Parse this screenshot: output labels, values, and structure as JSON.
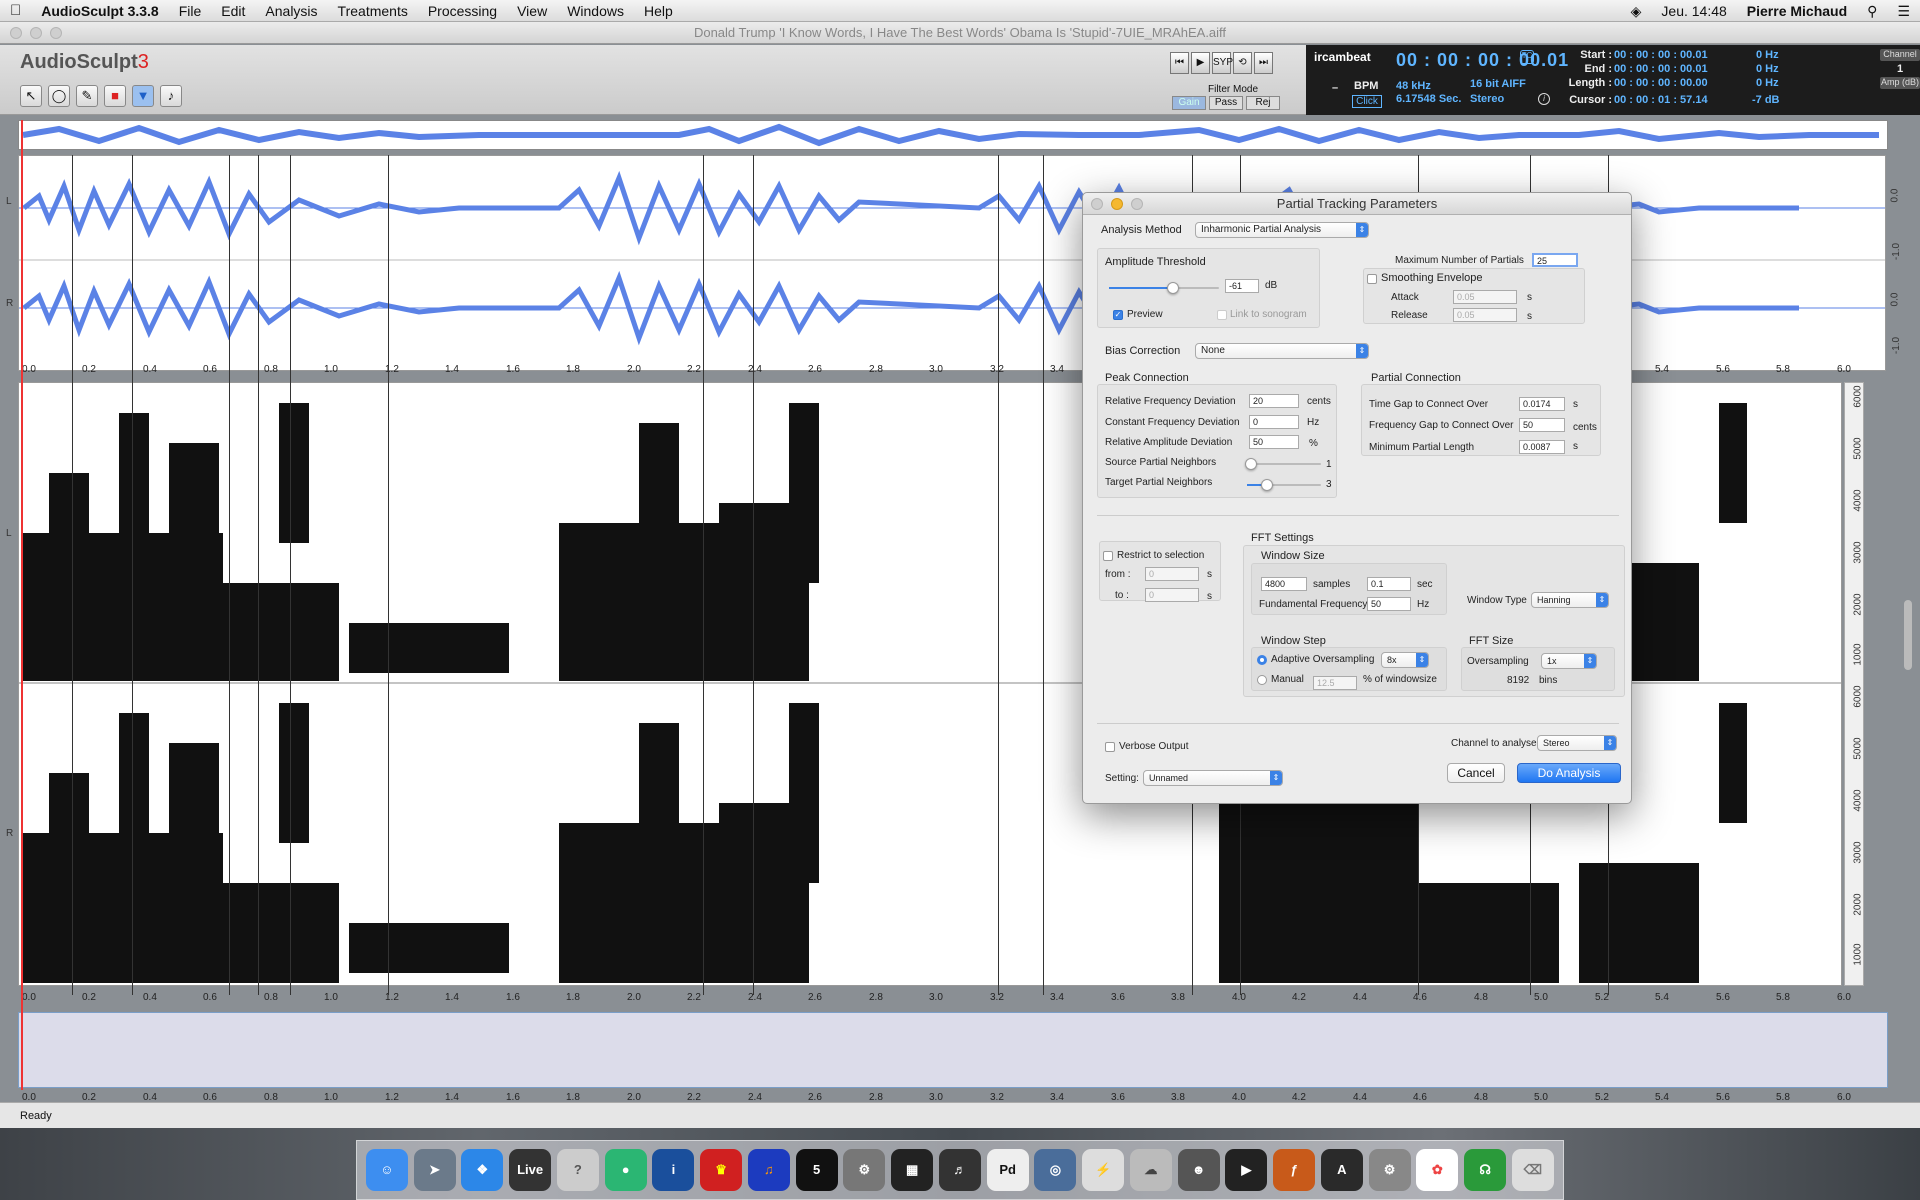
{
  "menubar": {
    "app": "AudioSculpt 3.3.8",
    "items": [
      "File",
      "Edit",
      "Analysis",
      "Treatments",
      "Processing",
      "View",
      "Windows",
      "Help"
    ],
    "clock": "Jeu. 14:48",
    "user": "Pierre Michaud"
  },
  "window": {
    "title": "Donald Trump 'I Know Words, I Have The Best Words' Obama Is 'Stupid'-7UIE_MRAhEA.aiff"
  },
  "toolbar": {
    "logo_text": "AudioSculpt",
    "logo_num": "3",
    "transport": [
      "⏮",
      "▶",
      "SYP",
      "⟲",
      "⏭"
    ],
    "filter_mode_label": "Filter Mode",
    "filter_buttons": [
      "Gain",
      "Pass",
      "Rej"
    ]
  },
  "info": {
    "brand": "ircambeat",
    "time": "00 : 00 : 00 : 00.01",
    "bpm": "BPM",
    "click": "Click",
    "rate": "48 kHz",
    "duration": "6.17548 Sec.",
    "format": "16 bit AIFF",
    "mode": "Stereo",
    "start_label": "Start :",
    "start": "00 : 00 : 00 : 00.01",
    "end_label": "End :",
    "end": "00 : 00 : 00 : 00.01",
    "length_label": "Length :",
    "length": "00 : 00 : 00 : 00.00",
    "cursor_label": "Cursor :",
    "cursor": "00 : 00 : 01 : 57.14",
    "hz1": "0 Hz",
    "hz2": "0 Hz",
    "hz3": "0 Hz",
    "hz4": "0 Hz",
    "amp": "-7 dB",
    "channel_label": "Channel",
    "channel": "1",
    "amp_label": "Amp (dB)"
  },
  "ruler_ticks": [
    "0.0",
    "0.2",
    "0.4",
    "0.6",
    "0.8",
    "1.0",
    "1.2",
    "1.4",
    "1.6",
    "1.8",
    "2.0",
    "2.2",
    "2.4",
    "2.6",
    "2.8",
    "3.0",
    "3.2",
    "3.4",
    "3.6",
    "3.8",
    "4.0",
    "4.2",
    "4.4",
    "4.6",
    "4.8",
    "5.0",
    "5.2",
    "5.4",
    "5.6",
    "5.8",
    "6.0"
  ],
  "freq_ticks": [
    "6000",
    "5000",
    "4000",
    "3000",
    "2000",
    "1000"
  ],
  "wave_scale": [
    "0.0",
    "-1.0"
  ],
  "channels": {
    "left": "L",
    "right": "R"
  },
  "status": "Ready",
  "dock": [
    "Finder",
    "Launchpad",
    "Safari",
    "Live",
    "?",
    "Rhythm",
    "Info",
    "Isadora",
    "Audacity",
    "5",
    "Settings",
    "Keys",
    "Pro",
    "Pd",
    "Radar",
    "Cable",
    "Cloud",
    "Mask",
    "Film",
    "ƒ",
    "A",
    "Prefs",
    "Photos",
    "Mic",
    "Trash"
  ],
  "dialog": {
    "title": "Partial Tracking Parameters",
    "analysis_method_label": "Analysis Method",
    "analysis_method": "Inharmonic Partial Analysis",
    "amp_threshold_label": "Amplitude Threshold",
    "amp_threshold": "-61",
    "amp_unit": "dB",
    "preview_label": "Preview",
    "link_label": "Link to sonogram",
    "max_partials_label": "Maximum Number of Partials",
    "max_partials": "25",
    "smoothing_label": "Smoothing Envelope",
    "attack_label": "Attack",
    "attack": "0.05",
    "release_label": "Release",
    "release": "0.05",
    "sec": "s",
    "bias_label": "Bias Correction",
    "bias": "None",
    "peak_label": "Peak Connection",
    "rel_freq_label": "Relative Frequency Deviation",
    "rel_freq": "20",
    "cents": "cents",
    "const_freq_label": "Constant Frequency Deviation",
    "const_freq": "0",
    "hz": "Hz",
    "rel_amp_label": "Relative Amplitude Deviation",
    "rel_amp": "50",
    "pct": "%",
    "src_neighbors_label": "Source Partial Neighbors",
    "src_neighbors": "1",
    "tgt_neighbors_label": "Target Partial Neighbors",
    "tgt_neighbors": "3",
    "partial_conn_label": "Partial Connection",
    "time_gap_label": "Time Gap to Connect Over",
    "time_gap": "0.0174",
    "freq_gap_label": "Frequency Gap to Connect Over",
    "freq_gap": "50",
    "min_len_label": "Minimum Partial Length",
    "min_len": "0.0087",
    "restrict_label": "Restrict to selection",
    "from_label": "from :",
    "from": "0",
    "to_label": "to :",
    "to": "0",
    "fft_label": "FFT Settings",
    "window_size_label": "Window Size",
    "samples": "4800",
    "samples_unit": "samples",
    "ws_sec": "0.1",
    "sec_unit": "sec",
    "fund_label": "Fundamental Frequency",
    "fund": "50",
    "window_type_label": "Window Type",
    "window_type": "Hanning",
    "window_step_label": "Window Step",
    "adaptive_label": "Adaptive Oversampling",
    "adaptive": "8x",
    "manual_label": "Manual",
    "manual": "12.5",
    "manual_unit": "% of windowsize",
    "fft_size_label": "FFT Size",
    "oversampling_label": "Oversampling",
    "oversampling": "1x",
    "bins": "8192",
    "bins_unit": "bins",
    "verbose_label": "Verbose Output",
    "channel_label": "Channel to analyse",
    "channel": "Stereo",
    "setting_label": "Setting:",
    "setting": "Unnamed",
    "cancel": "Cancel",
    "do_analysis": "Do Analysis"
  }
}
